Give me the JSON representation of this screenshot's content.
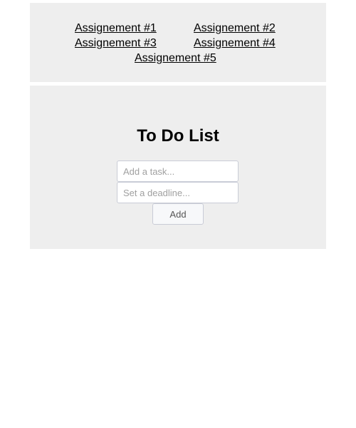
{
  "nav": {
    "links": [
      {
        "label": "Assignement #1"
      },
      {
        "label": "Assignement #2"
      },
      {
        "label": "Assignement #3"
      },
      {
        "label": "Assignement #4"
      },
      {
        "label": "Assignement #5"
      }
    ]
  },
  "todo": {
    "title": "To Do List",
    "task_input": {
      "value": "",
      "placeholder": "Add a task..."
    },
    "deadline_input": {
      "value": "",
      "placeholder": "Set a deadline..."
    },
    "add_label": "Add"
  },
  "colors": {
    "panel_background": "#eeeeee",
    "input_border": "#c9ccd6",
    "link_color": "#000000"
  }
}
